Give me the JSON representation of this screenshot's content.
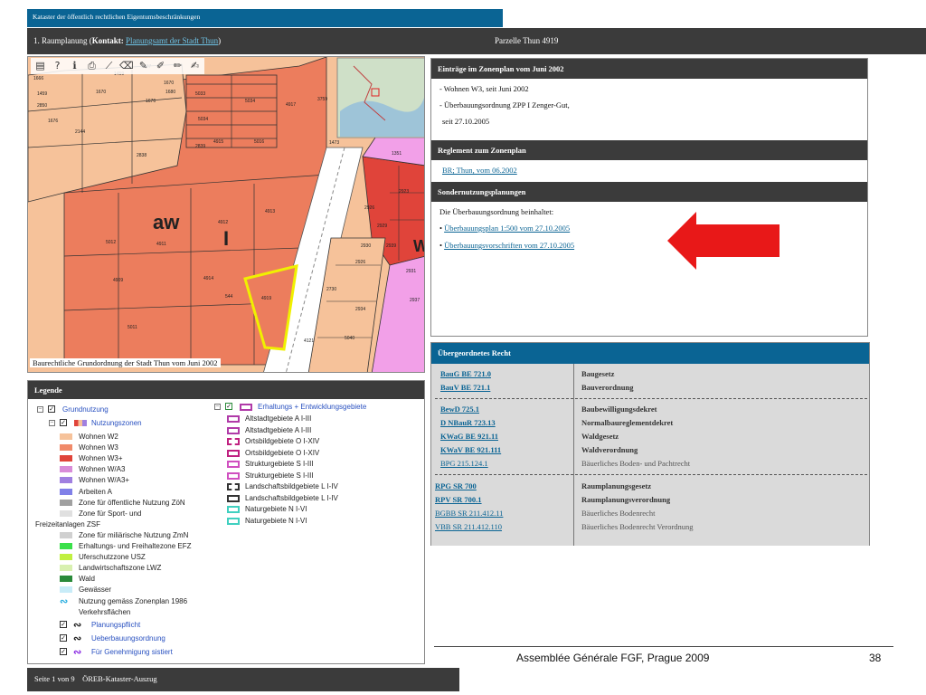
{
  "header": {
    "title": "Kataster der öffentlich rechtlichen Eigentumsbeschränkungen",
    "section_prefix": "1. Raumplanung (",
    "contact_label": "Kontakt:",
    "contact_link": "Planungsamt der Stadt Thun",
    "section_suffix": ")",
    "parcel": "Parzelle Thun 4919"
  },
  "map": {
    "caption": "Baurechtliche Grundordnung der Stadt Thun vom Juni 2002",
    "tools": [
      "layers-icon",
      "help-icon",
      "info-icon",
      "print-icon",
      "measure-icon",
      "erase-icon",
      "pencil-icon",
      "pencil2-icon",
      "edit-icon",
      "edit2-icon"
    ],
    "zone_label": "aw",
    "zone_sub": "I",
    "zone_label2": "W",
    "parcels": [
      "1459",
      "1437",
      "1666",
      "1670",
      "1676",
      "1680",
      "1670",
      "1459",
      "2850",
      "1676",
      "2144",
      "4917",
      "2838",
      "5033",
      "5034",
      "3759",
      "2839",
      "5034",
      "4915",
      "5016",
      "4912",
      "4913",
      "4911",
      "5012",
      "4914",
      "4909",
      "544",
      "4919",
      "5011",
      "2730",
      "1351",
      "2923",
      "2926",
      "2929",
      "2930",
      "2939",
      "2926",
      "2931",
      "2934",
      "2937",
      "5040",
      "1473",
      "4121"
    ]
  },
  "zonenplan": {
    "header": "Einträge im Zonenplan vom Juni 2002",
    "line1": "- Wohnen W3, seit Juni 2002",
    "line2": "- Überbauungsordnung ZPP I Zenger-Gut,",
    "line3": "seit 27.10.2005"
  },
  "reglement": {
    "header": "Reglement zum Zonenplan",
    "link": "BR; Thun, vom 06.2002"
  },
  "sonder": {
    "header": "Sondernutzungsplanungen",
    "intro": "Die Überbauungsordnung beinhaltet:",
    "link1": "Überbauungsplan 1:500 vom 27.10.2005",
    "link2": "Überbauungsvorschriften vom 27.10.2005",
    "bullet": "•"
  },
  "legal": {
    "header": "Übergeordnetes Recht",
    "groups": [
      [
        {
          "code": "BauG BE 721.0",
          "desc": "Baugesetz",
          "light": false
        },
        {
          "code": "BauV BE 721.1",
          "desc": "Bauverordnung",
          "light": false
        }
      ],
      [
        {
          "code": "BewD 725.1",
          "desc": "Baubewilligungsdekret",
          "light": false
        },
        {
          "code": "D NBauR 723.13",
          "desc": "Normalbaureglementdekret",
          "light": false
        },
        {
          "code": "KWaG BE 921.11",
          "desc": "Waldgesetz",
          "light": false
        },
        {
          "code": "KWaV BE 921.111",
          "desc": "Waldverordnung",
          "light": false
        },
        {
          "code": "BPG 215.124.1",
          "desc": "Bäuerliches Boden- und Pachtrecht",
          "light": true
        }
      ],
      [
        {
          "code": "RPG SR 700",
          "desc": "Raumplanungsgesetz",
          "light": false
        },
        {
          "code": "RPV SR 700.1",
          "desc": "Raumplanungsverordnung",
          "light": false
        },
        {
          "code": "BGBB SR 211.412.11",
          "desc": "Bäuerliches Bodenrecht",
          "light": true
        },
        {
          "code": "VBB SR 211.412.110",
          "desc": "Bäuerliches Bodenrecht Verordnung",
          "light": true
        }
      ]
    ]
  },
  "legend": {
    "header": "Legende",
    "grundnutzung": "Grundnutzung",
    "nutzungszonen": "Nutzungszonen",
    "left_items": [
      {
        "label": "Wohnen W2",
        "color": "#f6c29a"
      },
      {
        "label": "Wohnen W3",
        "color": "#f08a6a"
      },
      {
        "label": "Wohnen W3+",
        "color": "#e0443a"
      },
      {
        "label": "Wohnen W/A3",
        "color": "#d88cd8"
      },
      {
        "label": "Wohnen W/A3+",
        "color": "#a080e0"
      },
      {
        "label": "Arbeiten A",
        "color": "#8080e8"
      },
      {
        "label": "Zone für öffentliche Nutzung ZöN",
        "color": "#a0a0a0"
      },
      {
        "label": "Zone für Sport- und",
        "color": "#e0e0e0"
      },
      {
        "label": "Freizeitanlagen ZSF",
        "color": ""
      },
      {
        "label": "Zone für miliärische Nutzung ZmN",
        "color": "#d0d0d0"
      },
      {
        "label": "Erhaltungs- und Freihaltezone EFZ",
        "color": "#3ae04a"
      },
      {
        "label": "Uferschutzzone USZ",
        "color": "#c0f040"
      },
      {
        "label": "Landwirtschaftszone LWZ",
        "color": "#d8f0b0"
      },
      {
        "label": "Wald",
        "color": "#2a8a3a"
      },
      {
        "label": "Gewässer",
        "color": "#c8ecf8"
      },
      {
        "label": "Nutzung gemäss Zonenplan 1986",
        "color": ""
      },
      {
        "label": "Verkehrsflächen",
        "color": ""
      }
    ],
    "planungspflicht": "Planungspflicht",
    "ueberbauungsordnung": "Ueberbauungsordnung",
    "genehmigung": "Für Genehmigung sistiert",
    "right_header": "Erhaltungs + Entwicklungsgebiete",
    "right_items": [
      {
        "label": "Altstadtgebiete A I-III",
        "color": "#b03aa8",
        "style": "solid"
      },
      {
        "label": "Altstadtgebiete A I-III",
        "color": "#b03aa8",
        "style": "solid"
      },
      {
        "label": "Ortsbildgebiete O I-XIV",
        "color": "#c02080",
        "style": "dashed"
      },
      {
        "label": "Ortsbildgebiete O I-XIV",
        "color": "#c02080",
        "style": "solid"
      },
      {
        "label": "Strukturgebiete S I-III",
        "color": "#d050c0",
        "style": "solid"
      },
      {
        "label": "Strukturgebiete S I-III",
        "color": "#d050c0",
        "style": "solid"
      },
      {
        "label": "Landschaftsbildgebiete L I-IV",
        "color": "#333333",
        "style": "dashed"
      },
      {
        "label": "Landschaftsbildgebiete L I-IV",
        "color": "#333333",
        "style": "solid"
      },
      {
        "label": "Naturgebiete N I-VI",
        "color": "#40d0c0",
        "style": "solid"
      },
      {
        "label": "Naturgebiete N I-VI",
        "color": "#40d0c0",
        "style": "solid"
      }
    ]
  },
  "footer": {
    "conference": "Assemblée Générale FGF, Prague 2009",
    "slide_number": "38",
    "page_info": "Seite 1 von 9    ÖREB-Kataster-Auszug"
  }
}
